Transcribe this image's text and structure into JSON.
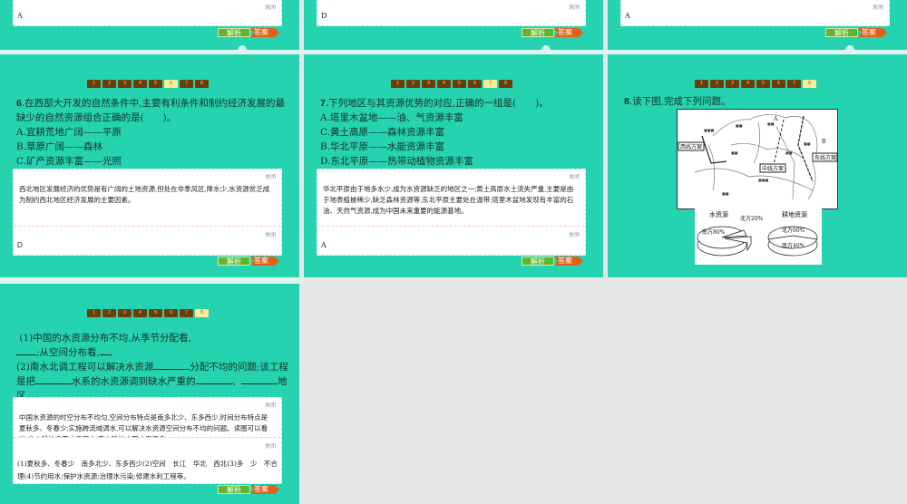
{
  "common": {
    "close": "关闭",
    "explain_btn": "解析",
    "answer_btn": "答案"
  },
  "nav": [
    "1",
    "2",
    "3",
    "4",
    "5",
    "6",
    "7",
    "8"
  ],
  "top_row": [
    {
      "answer": "A"
    },
    {
      "answer": "D"
    },
    {
      "answer": "A"
    }
  ],
  "q6": {
    "num": "6",
    "lines": [
      "在西部大开发的自然条件中,主要有利条件和制约经济发展的最",
      "缺少的自然资源组合正确的是(　　)。",
      "A.宜耕荒地广阔——平原",
      "B.草原广阔——森林",
      "C.矿产资源丰富——光照"
    ],
    "explanation": "西北地区发展经济的优势是有广阔的土地资源,但处在非季风区,降水少,水资源贫乏成为制约西北地区经济发展的主要因素。",
    "answer": "D"
  },
  "q7": {
    "num": "7",
    "lines": [
      ".下列地区与其资源优势的对应,正确的一组是(　　)。",
      "A.塔里木盆地——油、气资源丰富",
      "C.黄土高原——森林资源丰富",
      "B.华北平原——水能资源丰富",
      "D.东北平原——热带动植物资源丰富"
    ],
    "explanation": "华北平原由于地多水少,成为水资源缺乏的地区之一;黄土高原水土流失严重,主要是由于地表植被稀少,缺乏森林资源等;东北平原主要处在温带;塔里木盆地发现有丰富的石油、天然气资源,成为中国未来重要的能源基地。",
    "answer": "A"
  },
  "q8": {
    "num": "8",
    "title": ".读下图,完成下列问题。",
    "map_labels": {
      "west": "西线方案",
      "middle": "中线方案",
      "east": "东线方案",
      "a": "A",
      "b": "B"
    },
    "pies": [
      {
        "title": "水资源",
        "slices": [
          {
            "label": "南方80%",
            "value": 80
          },
          {
            "label": "北方20%",
            "value": 20
          }
        ]
      },
      {
        "title": "耕地资源",
        "slices": [
          {
            "label": "北方60%",
            "value": 60
          },
          {
            "label": "南方40%",
            "value": 40
          }
        ]
      }
    ]
  },
  "q8b": {
    "l1": "(1)中国的水资源分布不均,从季节分配看,",
    "l2": ";从空间分布看,",
    "l2end": "。",
    "l3a": "(2)南水北调工程可以解决水资源",
    "l3b": "分配不均的问题;该工程",
    "l4a": "是把",
    "l4b": "水系的水资源调到缺水严重的",
    "l4c": "、",
    "l4d": "地",
    "l5": "区。",
    "explanation": "中国水资源的时空分布不均匀,空间分布特点是南多北少、东多西少,时间分布特点是夏秋多、冬春少;实施跨流域调水,可以解决水资源空间分布不均的问题。读图可以看出,北方耕地多而水资源少,南方耕地少而水资源多。",
    "answer": "(1)夏秋多、冬春少　南多北少、东多西少(2)空间　长江　华北　西北(3)多　少　不合理(4)节约用水;保护水资源;治理水污染;修建水利工程等。"
  }
}
